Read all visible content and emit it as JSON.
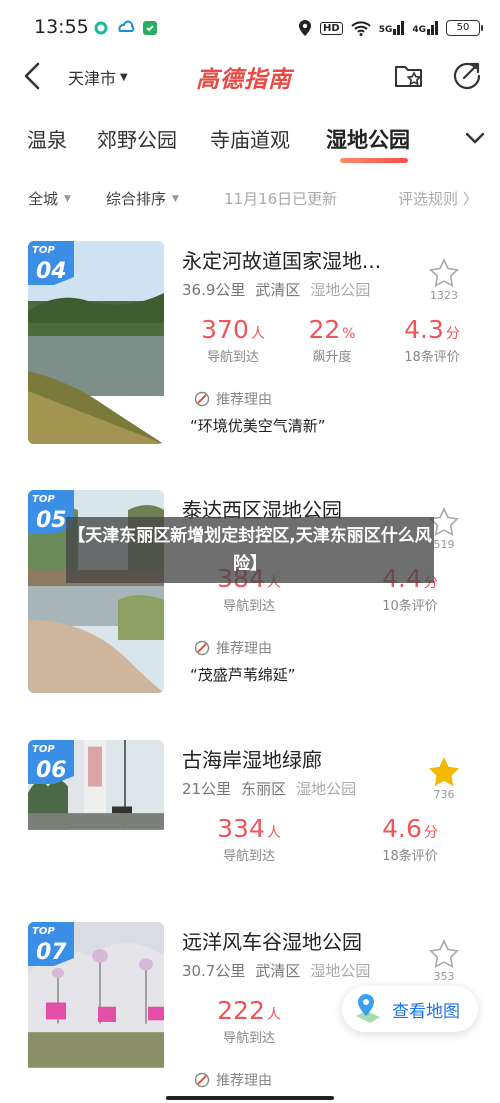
{
  "status": {
    "time": "13:55",
    "battery": "50",
    "hd": "HD",
    "net1": "5G",
    "net2": "4G"
  },
  "nav": {
    "city": "天津市",
    "logo_text": "高德指南"
  },
  "tabs": [
    {
      "label": "温泉"
    },
    {
      "label": "郊野公园"
    },
    {
      "label": "寺庙道观"
    },
    {
      "label": "湿地公园",
      "active": true
    }
  ],
  "filters": {
    "area": "全城",
    "sort": "综合排序",
    "update": "11月16日已更新",
    "rules": "评选规则 〉"
  },
  "overlay_text": "【天津东丽区新增划定封控区,天津东丽区什么风险】",
  "cards": [
    {
      "rank": "04",
      "rank_label": "TOP",
      "title": "永定河故道国家湿地...",
      "distance": "36.9公里",
      "district": "武清区",
      "type": "湿地公园",
      "fav_count": "1323",
      "favorited": false,
      "nav_value": "370",
      "nav_unit": "人",
      "nav_label": "导航到达",
      "rise_value": "22",
      "rise_unit": "%",
      "rise_label": "飙升度",
      "score_value": "4.3",
      "score_unit": "分",
      "score_label": "18条评价",
      "reason_label": "推荐理由",
      "reason": "“环境优美空气清新”"
    },
    {
      "rank": "05",
      "rank_label": "TOP",
      "title": "泰达西区湿地公园",
      "fav_count": "519",
      "favorited": false,
      "nav_value": "384",
      "nav_unit": "人",
      "nav_label": "导航到达",
      "score_value": "4.4",
      "score_unit": "分",
      "score_label": "10条评价",
      "reason_label": "推荐理由",
      "reason": "“茂盛芦苇绵延”"
    },
    {
      "rank": "06",
      "rank_label": "TOP",
      "title": "古海岸湿地绿廊",
      "distance": "21公里",
      "district": "东丽区",
      "type": "湿地公园",
      "fav_count": "736",
      "favorited": true,
      "nav_value": "334",
      "nav_unit": "人",
      "nav_label": "导航到达",
      "score_value": "4.6",
      "score_unit": "分",
      "score_label": "18条评价"
    },
    {
      "rank": "07",
      "rank_label": "TOP",
      "title": "远洋风车谷湿地公园",
      "distance": "30.7公里",
      "district": "武清区",
      "type": "湿地公园",
      "fav_count": "353",
      "favorited": false,
      "nav_value": "222",
      "nav_unit": "人",
      "nav_label": "导航到达",
      "reason_label": "推荐理由"
    }
  ],
  "map_button": {
    "label": "查看地图"
  },
  "colors": {
    "accent_red": "#f0555b",
    "badge_blue": "#3a8ee6",
    "map_blue": "#1a73e8",
    "star_gold": "#f5b800"
  }
}
